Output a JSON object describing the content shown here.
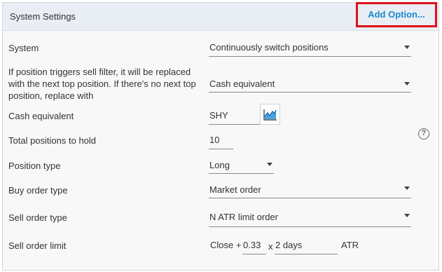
{
  "panel": {
    "title": "System Settings",
    "add_option_label": "Add Option..."
  },
  "rows": {
    "system": {
      "label": "System",
      "value": "Continuously switch positions"
    },
    "replace": {
      "label_line1": "If position triggers sell filter, it will be replaced",
      "label_line2": "with the next top position. If there's no next top",
      "label_line3": "position, replace with",
      "value": "Cash equivalent"
    },
    "cash_equivalent": {
      "label": "Cash equivalent",
      "value": "SHY"
    },
    "total_positions": {
      "label": "Total positions to hold",
      "value": "10"
    },
    "position_type": {
      "label": "Position type",
      "value": "Long"
    },
    "buy_order_type": {
      "label": "Buy order type",
      "value": "Market order"
    },
    "sell_order_type": {
      "label": "Sell order type",
      "value": "N ATR limit order"
    },
    "sell_order_limit": {
      "label": "Sell order limit",
      "prefix": "Close +",
      "multiplier": "0.33",
      "x_text": "x",
      "days": "2 days",
      "unit": "ATR"
    }
  },
  "icons": {
    "chart": "line-chart-icon",
    "help": "help-icon",
    "dropdown": "caret-down-icon"
  },
  "colors": {
    "accent": "#1e88d0",
    "highlight": "#e0101a",
    "chart_fill": "#4aa3df"
  },
  "help_glyph": "?"
}
